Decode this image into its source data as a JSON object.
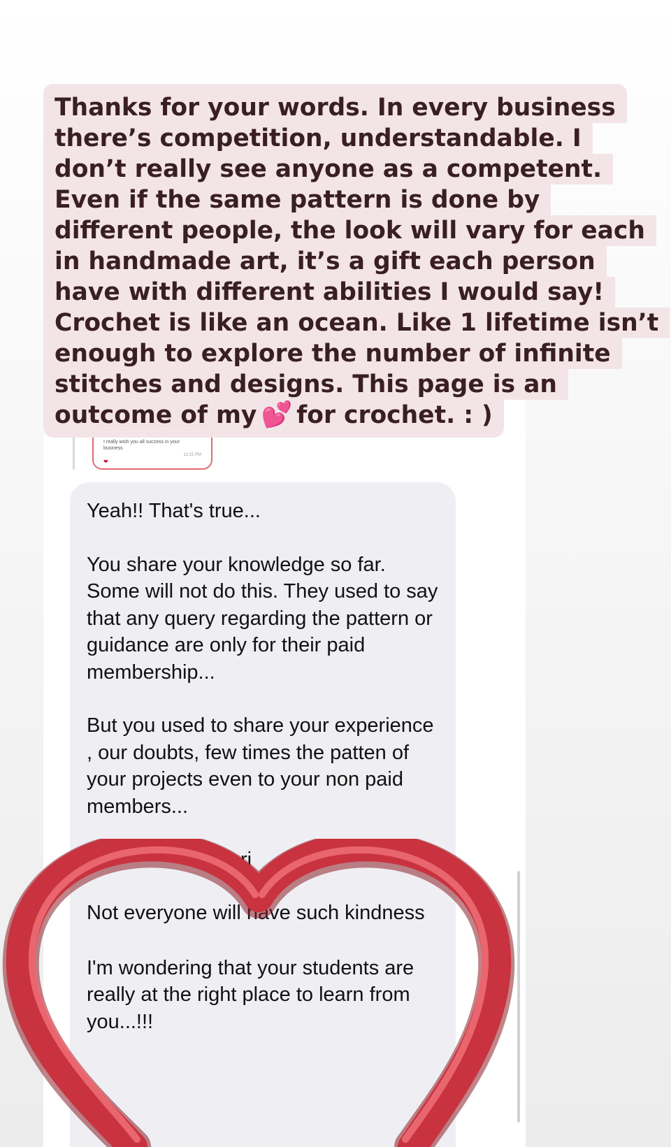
{
  "caption": {
    "lines": [
      "Thanks for your words. In every business",
      "there’s competition, understandable. I",
      "don’t really see anyone as a competent.",
      "Even if the same pattern is done by",
      "different people, the look will vary for each",
      "in handmade art, it’s a gift each person",
      "have with different abilities I would say!",
      "Crochet is like an ocean. Like 1 lifetime isn’t",
      "enough to explore the number of infinite",
      "stitches and designs. This page is an",
      "outcome of my"
    ],
    "heart_emoji": "💕",
    "end_text": "for crochet. : )"
  },
  "reply_preview": {
    "text": "I really wish you all success in your business",
    "time": "12:22 PM",
    "heart": "❤"
  },
  "message": {
    "p1": "Yeah!! That's true...",
    "p2": "You share your knowledge so far. Some will not do this. They used to say that any query regarding the pattern or guidance are only for their paid membership...",
    "p3": "But you used to share your experience , our doubts, few times the patten of your projects even to your non paid members...",
    "p4_partial": "ri",
    "p5": "Not everyone will have such kindness",
    "p6": "I'm wondering that your students are really at the right place to learn from you...!!!",
    "reaction": "❤️"
  },
  "colors": {
    "caption_bg": "#f3e4e6",
    "caption_text": "#3a1f22",
    "bubble_bg": "#efeff3",
    "heart_sticker": "#c8333f"
  },
  "icons": {
    "sticker": "heart-outline-sticker",
    "reaction": "red-heart-icon",
    "caption_emoji": "two-hearts-icon"
  }
}
